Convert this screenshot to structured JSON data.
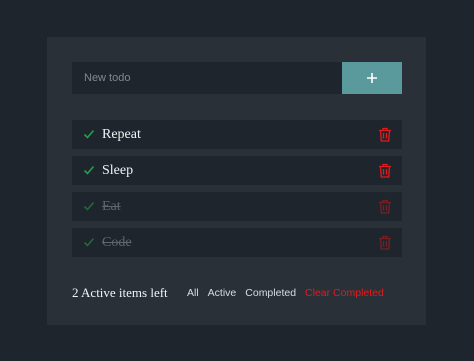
{
  "input": {
    "placeholder": "New todo"
  },
  "add_button": {
    "icon": "plus-icon"
  },
  "todos": [
    {
      "text": "Repeat",
      "completed": false
    },
    {
      "text": "Sleep",
      "completed": false
    },
    {
      "text": "Eat",
      "completed": true
    },
    {
      "text": "Code",
      "completed": true
    }
  ],
  "footer": {
    "active_count": "2 Active items left",
    "filters": {
      "all": "All",
      "active": "Active",
      "completed": "Completed"
    },
    "clear": "Clear Completed"
  },
  "colors": {
    "background": "#1f252d",
    "card": "#2a3038",
    "accent": "#5a9a9c",
    "check": "#1fa34a",
    "delete": "#e31b1b"
  }
}
